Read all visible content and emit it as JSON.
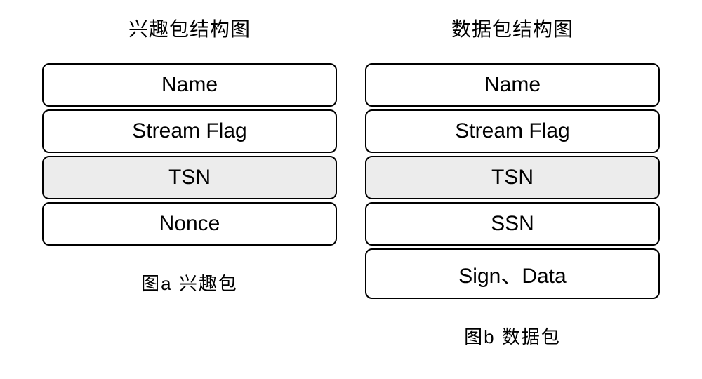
{
  "left": {
    "title": "兴趣包结构图",
    "fields": {
      "f0": "Name",
      "f1": "Stream  Flag",
      "f2": "TSN",
      "f3": "Nonce"
    },
    "caption": "图a  兴趣包"
  },
  "right": {
    "title": "数据包结构图",
    "fields": {
      "f0": "Name",
      "f1": "Stream  Flag",
      "f2": "TSN",
      "f3": "SSN",
      "f4": "Sign、Data"
    },
    "caption": "图b  数据包"
  }
}
